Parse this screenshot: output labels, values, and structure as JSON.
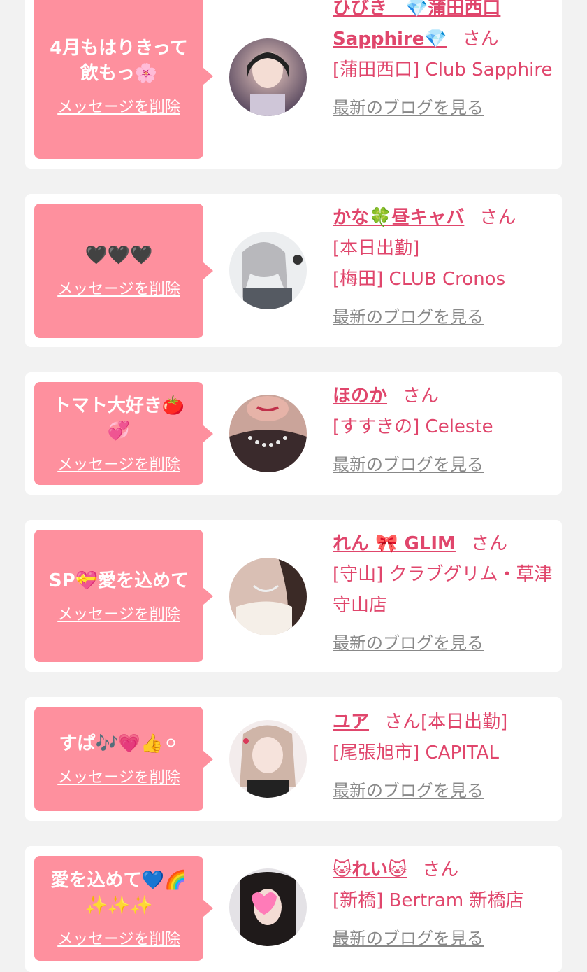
{
  "delete_label": "メッセージを削除",
  "blog_label": "最新のブログを見る",
  "san_label": "さん",
  "colors": {
    "background": "#f2f2f2",
    "card": "#ffffff",
    "message_box": "#fe909e",
    "accent_text": "#e0466c",
    "link_gray": "#888888"
  },
  "entries": [
    {
      "message": "4月もはりきって飲もっ🌸",
      "name": "ひびき　💎蒲田西口Sapphire💎",
      "shop_lines": [
        "[蒲田西口] Club Sapphire"
      ],
      "inline_shop": "",
      "avatar": "avatar-hibiki"
    },
    {
      "message": "🖤🖤🖤",
      "name": "かな🍀昼キャバ",
      "shop_lines": [
        "[本日出勤]",
        "[梅田] CLUB Cronos"
      ],
      "inline_shop": "",
      "avatar": "avatar-kana"
    },
    {
      "message": "トマト大好き🍅💞",
      "name": "ほのか",
      "shop_lines": [
        "[すすきの] Celeste"
      ],
      "inline_shop": "",
      "avatar": "avatar-honoka"
    },
    {
      "message": "SP💝愛を込めて",
      "name": "れん 🎀 GLIM",
      "shop_lines": [
        "[守山] クラブグリム・草津守山店"
      ],
      "inline_shop": "",
      "avatar": "avatar-ren"
    },
    {
      "message": "すぱ🎶💗👍⚪",
      "name": "ユア",
      "shop_lines": [
        "[尾張旭市] CAPITAL"
      ],
      "inline_shop": "[本日出勤]",
      "avatar": "avatar-yua"
    },
    {
      "message": "愛を込めて💙🌈✨✨✨",
      "name": "🐱れい🐱",
      "shop_lines": [
        "[新橋] Bertram 新橋店"
      ],
      "inline_shop": "",
      "avatar": "avatar-rei"
    }
  ]
}
